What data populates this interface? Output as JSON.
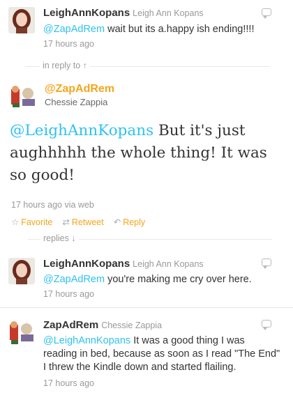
{
  "tweets_above": [
    {
      "handle": "LeighAnnKopans",
      "fullname": "Leigh Ann Kopans",
      "mention": "@ZapAdRem",
      "body": " wait but its a.happy ish ending!!!!",
      "time": "17 hours ago"
    }
  ],
  "in_reply_to_label": "in reply to ↑",
  "main_tweet": {
    "handle": "@ZapAdRem",
    "fullname": "Chessie Zappia",
    "mention": "@LeighAnnKopans",
    "body": " But it's just aughhhhh the whole thing! It was so good!",
    "meta": "17 hours ago via web",
    "actions": {
      "favorite": "Favorite",
      "retweet": "Retweet",
      "reply": "Reply"
    }
  },
  "replies_label": "replies ↓",
  "replies": [
    {
      "handle": "LeighAnnKopans",
      "fullname": "Leigh Ann Kopans",
      "mention": "@ZapAdRem",
      "body": " you're making me cry over here.",
      "time": "17 hours ago"
    },
    {
      "handle": "ZapAdRem",
      "fullname": "Chessie Zappia",
      "mention": "@LeighAnnKopans",
      "body": " It was a good thing I was reading in bed, because as soon as I read \"The End\" I threw the Kindle down and started flailing.",
      "time": "17 hours ago"
    }
  ],
  "colors": {
    "accent_orange": "#f5a51b",
    "mention_blue": "#2fc2ef",
    "muted_gray": "#999999"
  },
  "icons": [
    "star-icon",
    "retweet-icon",
    "reply-icon",
    "caret-icon"
  ]
}
